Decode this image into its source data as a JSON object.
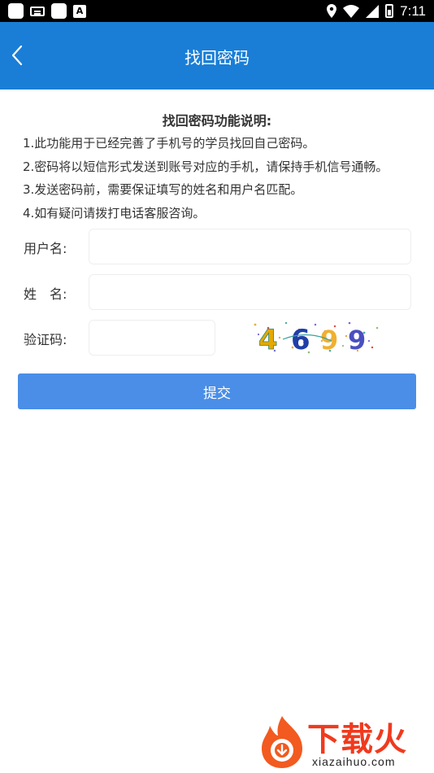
{
  "status_bar": {
    "time": "7:11",
    "left_icons": [
      "app-square-icon",
      "keyboard-icon",
      "app-square-icon",
      "font-a-icon"
    ],
    "font_icon_letter": "A",
    "right_icons": [
      "location-icon",
      "wifi-icon",
      "signal-icon",
      "battery-icon"
    ]
  },
  "nav": {
    "title": "找回密码",
    "back_icon": "chevron-left-icon",
    "background": "#1a7ed6"
  },
  "info": {
    "title": "找回密码功能说明:",
    "lines": [
      "1.此功能用于已经完善了手机号的学员找回自己密码。",
      "2.密码将以短信形式发送到账号对应的手机，请保持手机信号通畅。",
      "3.发送密码前，需要保证填写的姓名和用户名匹配。",
      "4.如有疑问请拨打电话客服咨询。"
    ]
  },
  "form": {
    "username_label": "用户名:",
    "username_value": "",
    "name_label": "姓　名:",
    "name_value": "",
    "captcha_label": "验证码:",
    "captcha_value": "",
    "captcha_text": "4699",
    "submit_label": "提交",
    "submit_color": "#4a8ee8"
  },
  "watermark": {
    "brand": "下载火",
    "url": "xiazaihuo.com",
    "color": "#f03a1e"
  }
}
